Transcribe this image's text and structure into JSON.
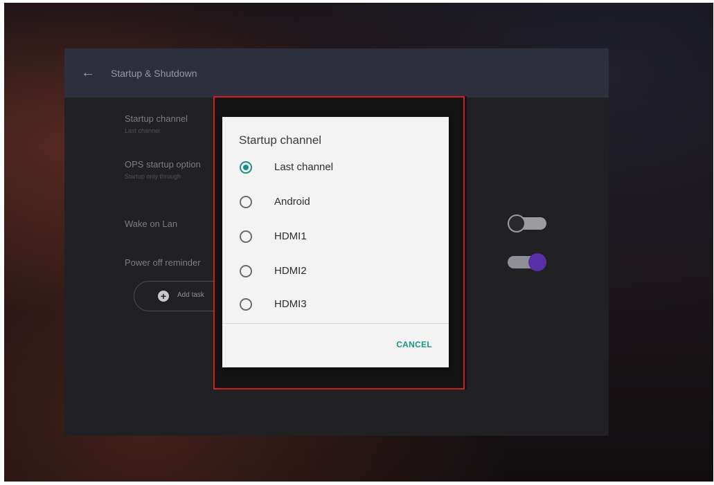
{
  "header": {
    "back_icon": "arrow-left-icon",
    "title": "Startup & Shutdown"
  },
  "settings": {
    "startup_channel": {
      "title": "Startup channel",
      "subtitle": "Last channel"
    },
    "ops_startup": {
      "title": "OPS startup option",
      "subtitle": "Startup only through"
    },
    "wake_on_lan": {
      "title": "Wake on Lan",
      "enabled": false
    },
    "power_off_reminder": {
      "title": "Power off reminder",
      "enabled": true
    },
    "add_task": {
      "icon": "plus-circle-icon",
      "label": "Add task"
    }
  },
  "dialog": {
    "title": "Startup channel",
    "options": [
      "Last channel",
      "Android",
      "HDMI1",
      "HDMI2",
      "HDMI3"
    ],
    "selected": "Last channel",
    "cancel_label": "CANCEL"
  },
  "colors": {
    "accent": "#1a8f86",
    "toggle_on": "#5b2ea8",
    "highlight": "#d21f1f",
    "panel": "#212124"
  }
}
